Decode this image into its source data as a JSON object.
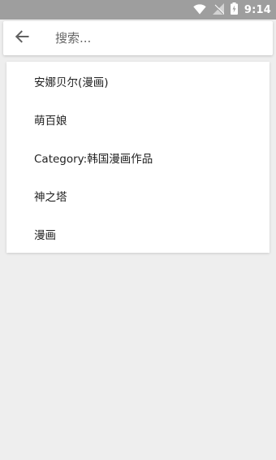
{
  "status_bar": {
    "time": "9:14",
    "icons": [
      "wifi-icon",
      "signal-icon",
      "battery-icon"
    ]
  },
  "search": {
    "back_icon": "arrow-left-icon",
    "placeholder": "搜索...",
    "value": ""
  },
  "suggestions": [
    {
      "label": "安娜贝尔(漫画)"
    },
    {
      "label": "萌百娘"
    },
    {
      "label": "Category:韩国漫画作品"
    },
    {
      "label": "神之塔"
    },
    {
      "label": "漫画"
    }
  ],
  "colors": {
    "status_bar": "#9e9e9e",
    "background": "#eeeeee",
    "surface": "#ffffff"
  }
}
